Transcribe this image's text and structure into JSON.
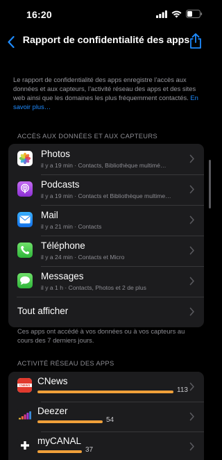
{
  "status": {
    "time": "16:20"
  },
  "nav": {
    "title": "Rapport de confidentialité des apps"
  },
  "intro": {
    "text": "Le rapport de confidentialité des apps enregistre l’accès aux données et aux capteurs, l’activité réseau des apps et des sites web ainsi que les domaines les plus fréquemment contactés.",
    "link": "En savoir plus…"
  },
  "access_section": {
    "header": "ACCÈS AUX DONNÉES ET AUX CAPTEURS",
    "items": [
      {
        "title": "Photos",
        "subtitle": "il y a 19 min · Contacts, Bibliothèque multimé…",
        "icon": "photos-icon"
      },
      {
        "title": "Podcasts",
        "subtitle": "il y a 19 min · Contacts et Bibliothèque multime…",
        "icon": "podcasts-icon"
      },
      {
        "title": "Mail",
        "subtitle": "il y a 21 min · Contacts",
        "icon": "mail-icon"
      },
      {
        "title": "Téléphone",
        "subtitle": "il y a 24 min · Contacts et Micro",
        "icon": "phone-icon"
      },
      {
        "title": "Messages",
        "subtitle": "il y a 1 h · Contacts, Photos et 2 de plus",
        "icon": "messages-icon"
      }
    ],
    "show_all": "Tout afficher",
    "footer": "Ces apps ont accédé à vos données ou à vos capteurs au cours des 7 derniers jours."
  },
  "network_section": {
    "header": "ACTIVITÉ RÉSEAU DES APPS",
    "items": [
      {
        "title": "CNews",
        "value": 113,
        "icon": "cnews-icon"
      },
      {
        "title": "Deezer",
        "value": 54,
        "icon": "deezer-icon"
      },
      {
        "title": "myCANAL",
        "value": 37,
        "icon": "mycanal-icon"
      }
    ]
  },
  "colors": {
    "accent": "#1e8bff",
    "bar": "#f0a03a",
    "card": "#1c1c1e"
  }
}
